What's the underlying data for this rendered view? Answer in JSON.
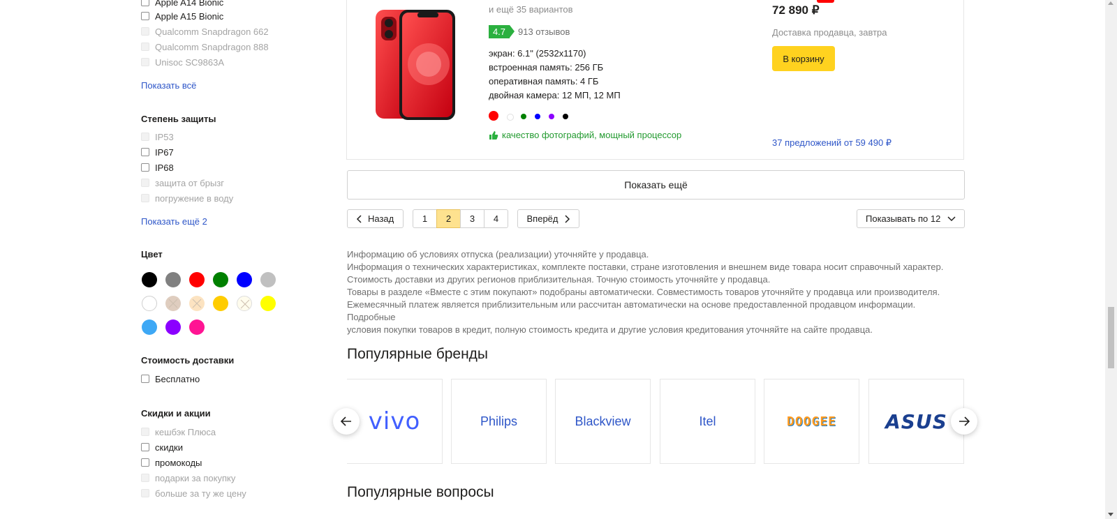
{
  "sidebar": {
    "processor_items": [
      {
        "label": "Apple A14 Bionic",
        "enabled": true
      },
      {
        "label": "Apple A15 Bionic",
        "enabled": true
      },
      {
        "label": "Qualcomm Snapdragon 662",
        "enabled": false
      },
      {
        "label": "Qualcomm Snapdragon 888",
        "enabled": false
      },
      {
        "label": "Unisoc SC9863A",
        "enabled": false
      }
    ],
    "processor_show_all": "Показать всё",
    "protection_title": "Степень защиты",
    "protection_items": [
      {
        "label": "IP53",
        "enabled": false
      },
      {
        "label": "IP67",
        "enabled": true
      },
      {
        "label": "IP68",
        "enabled": true
      },
      {
        "label": "защита от брызг",
        "enabled": false
      },
      {
        "label": "погружение в воду",
        "enabled": false
      }
    ],
    "protection_show_more": "Показать ещё 2",
    "color_title": "Цвет",
    "colors": [
      "#000000",
      "#808080",
      "#ff0000",
      "#008000",
      "#0000ff",
      "#c0c0c0",
      "#ffffff",
      "#d2b8a5",
      "#fbd8a8",
      "#ffcc00",
      "#fffbe6",
      "#ffff00",
      "#3ea8f5",
      "#8b00ff",
      "#ff1493"
    ],
    "delivery_title": "Стоимость доставки",
    "delivery_items": [
      {
        "label": "Бесплатно",
        "enabled": true
      }
    ],
    "discount_title": "Скидки и акции",
    "discount_items": [
      {
        "label": "кешбэк Плюса",
        "enabled": false
      },
      {
        "label": "скидки",
        "enabled": true
      },
      {
        "label": "промокоды",
        "enabled": true
      },
      {
        "label": "подарки за покупку",
        "enabled": false
      },
      {
        "label": "больше за ту же цену",
        "enabled": false
      }
    ]
  },
  "product": {
    "variants": "и ещё 35 вариантов",
    "rating": "4.7",
    "reviews": "913 отзывов",
    "specs": [
      "экран: 6.1\" (2532x1170)",
      "встроенная память: 256 ГБ",
      "оперативная память: 4 ГБ",
      "двойная камера: 12 МП, 12 МП"
    ],
    "color_dots": [
      "#ff0000",
      "#ffffff",
      "#008000",
      "#0000ff",
      "#8b00ff",
      "#000000"
    ],
    "feature": "качество фотографий, мощный процессор",
    "price": "72 890 ₽",
    "delivery": "Доставка продавца, завтра",
    "cart_button": "В корзину",
    "offers": "37 предложений от 59 490 ₽"
  },
  "show_more": "Показать ещё",
  "pagination": {
    "back": "Назад",
    "pages": [
      "1",
      "2",
      "3",
      "4"
    ],
    "current": "2",
    "forward": "Вперёд",
    "per_page": "Показывать по 12"
  },
  "info": [
    "Информацию об условиях отпуска (реализации) уточняйте у продавца.",
    "Информация о технических характеристиках, комплекте поставки, стране изготовления и внешнем виде товара носит справочный характер.",
    "Стоимость доставки из других регионов приблизительная. Точную стоимость уточняйте у продавца.",
    "Товары в разделе «Вместе с этим покупают» подобраны автоматически. Совместимость товаров уточняйте у продавца или производителя.",
    "Ежемесячный платеж является приблизительным или рассчитан автоматически на основе предоставленной продавцом информации. Подробные",
    "условия покупки товаров в кредит, полную стоимость кредита и другие условия кредитования уточняйте на сайте продавца."
  ],
  "brands_title": "Популярные бренды",
  "brands": [
    "vivo",
    "Philips",
    "Blackview",
    "Itel",
    "DOOGEE",
    "ASUS"
  ],
  "questions_title": "Популярные вопросы"
}
